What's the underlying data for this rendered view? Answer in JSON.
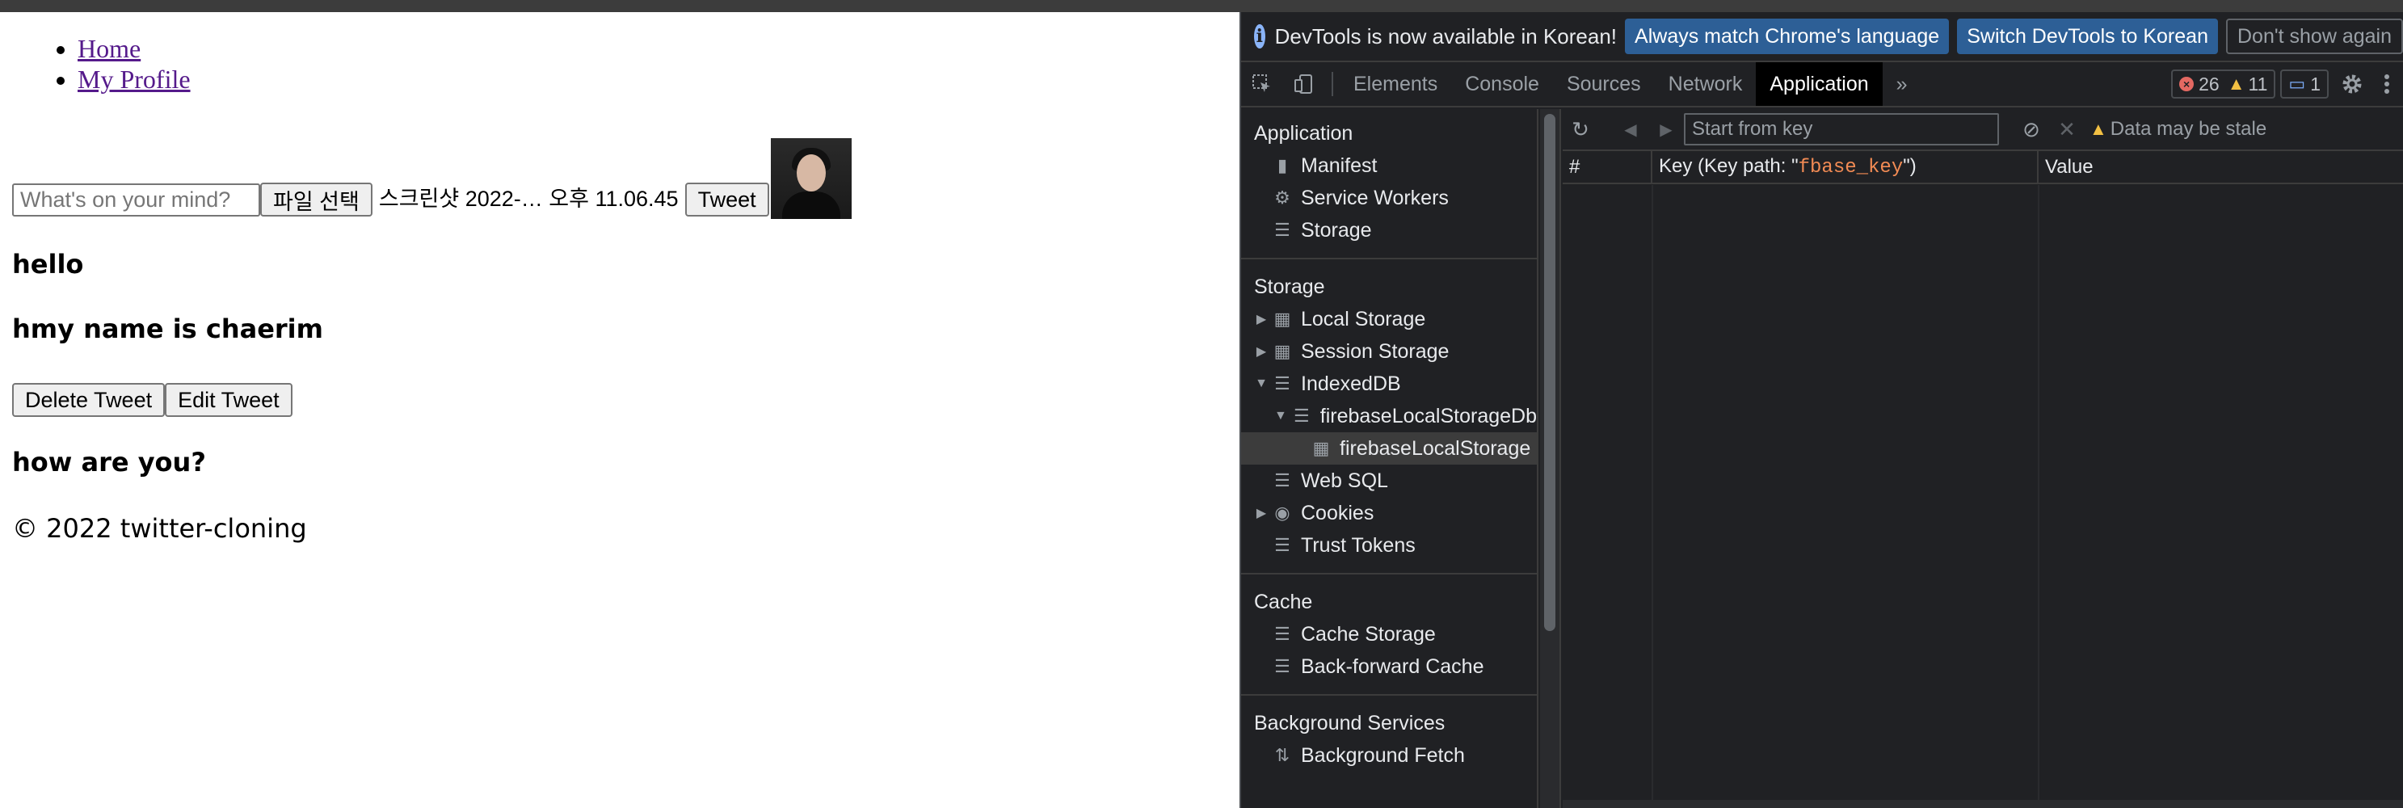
{
  "page": {
    "nav": [
      {
        "label": "Home"
      },
      {
        "label": "My Profile"
      }
    ],
    "form": {
      "placeholder": "What's on your mind?",
      "file_button": "파일 선택",
      "file_name": "스크린샷 2022-… 오후 11.06.45",
      "submit": "Tweet"
    },
    "tweets": [
      {
        "text": "hello"
      },
      {
        "text": "hmy name is chaerim"
      },
      {
        "text": "how are you?"
      }
    ],
    "actions": {
      "delete": "Delete Tweet",
      "edit": "Edit Tweet"
    },
    "footer": "© 2022 twitter-cloning"
  },
  "devtools": {
    "infobar": {
      "message": "DevTools is now available in Korean!",
      "match_button": "Always match Chrome's language",
      "switch_button": "Switch DevTools to Korean",
      "dismiss_button": "Don't show again"
    },
    "tabs": [
      "Elements",
      "Console",
      "Sources",
      "Network",
      "Application"
    ],
    "active_tab": "Application",
    "more_tabs": "»",
    "badges": {
      "errors": "26",
      "warnings": "11",
      "messages": "1"
    },
    "sidebar": {
      "application_title": "Application",
      "application_items": [
        "Manifest",
        "Service Workers",
        "Storage"
      ],
      "storage_title": "Storage",
      "storage_items": [
        "Local Storage",
        "Session Storage",
        "IndexedDB",
        "firebaseLocalStorageDb",
        "firebaseLocalStorage",
        "Web SQL",
        "Cookies",
        "Trust Tokens"
      ],
      "cache_title": "Cache",
      "cache_items": [
        "Cache Storage",
        "Back-forward Cache"
      ],
      "bg_title": "Background Services",
      "bg_items": [
        "Background Fetch"
      ]
    },
    "toolbar": {
      "key_placeholder": "Start from key",
      "stale_text": "Data may be stale"
    },
    "table": {
      "col_index": "#",
      "col_key_prefix": "Key (Key path: \"",
      "col_key_path": "fbase_key",
      "col_key_suffix": "\")",
      "col_value": "Value"
    }
  }
}
